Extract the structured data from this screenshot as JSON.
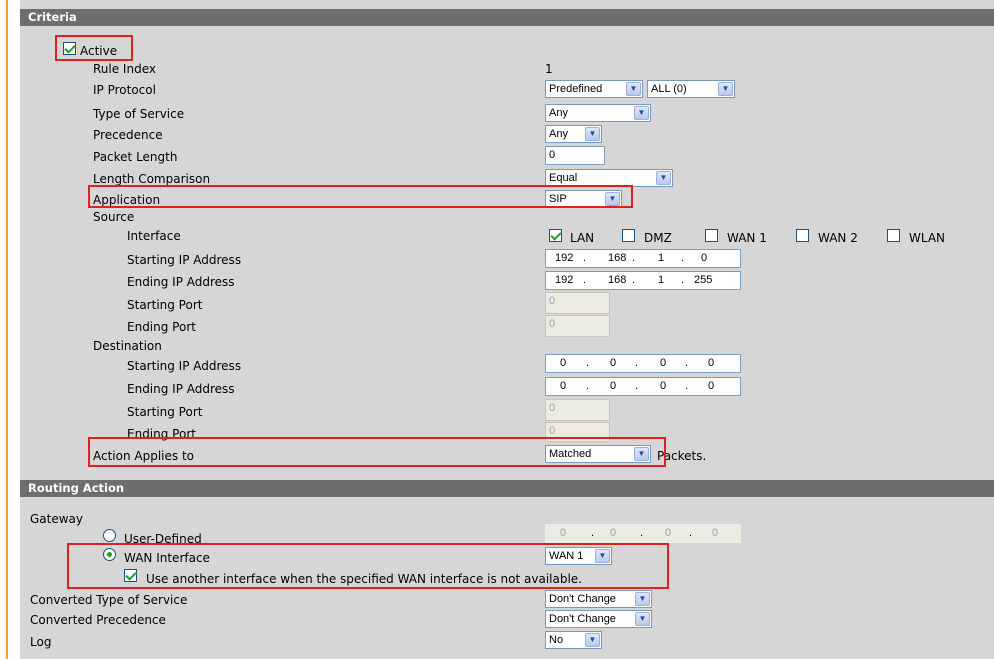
{
  "criteria": {
    "header": "Criteria",
    "active_label": "Active",
    "rule_index_label": "Rule Index",
    "rule_index_value": "1",
    "ip_protocol_label": "IP Protocol",
    "ip_protocol_value": "Predefined",
    "ip_protocol_sub_value": "ALL (0)",
    "tos_label": "Type of Service",
    "tos_value": "Any",
    "precedence_label": "Precedence",
    "precedence_value": "Any",
    "packet_length_label": "Packet Length",
    "packet_length_value": "0",
    "length_comparison_label": "Length Comparison",
    "length_comparison_value": "Equal",
    "application_label": "Application",
    "application_value": "SIP",
    "source_label": "Source",
    "interface_label": "Interface",
    "interfaces": [
      {
        "label": "LAN",
        "checked": true
      },
      {
        "label": "DMZ",
        "checked": false
      },
      {
        "label": "WAN 1",
        "checked": false
      },
      {
        "label": "WAN 2",
        "checked": false
      },
      {
        "label": "WLAN",
        "checked": false
      }
    ],
    "src_start_ip_label": "Starting IP Address",
    "src_start_ip": [
      "192",
      "168",
      "1",
      "0"
    ],
    "src_end_ip_label": "Ending IP Address",
    "src_end_ip": [
      "192",
      "168",
      "1",
      "255"
    ],
    "src_start_port_label": "Starting Port",
    "src_start_port": "0",
    "src_end_port_label": "Ending Port",
    "src_end_port": "0",
    "destination_label": "Destination",
    "dst_start_ip_label": "Starting IP Address",
    "dst_start_ip": [
      "0",
      "0",
      "0",
      "0"
    ],
    "dst_end_ip_label": "Ending IP Address",
    "dst_end_ip": [
      "0",
      "0",
      "0",
      "0"
    ],
    "dst_start_port_label": "Starting Port",
    "dst_start_port": "0",
    "dst_end_port_label": "Ending Port",
    "dst_end_port": "0",
    "action_applies_label": "Action Applies to",
    "action_applies_value": "Matched",
    "packets_label": "Packets."
  },
  "routing": {
    "header": "Routing Action",
    "gateway_label": "Gateway",
    "user_defined_label": "User-Defined",
    "user_defined_ip": [
      "0",
      "0",
      "0",
      "0"
    ],
    "wan_interface_label": "WAN Interface",
    "wan_interface_value": "WAN 1",
    "fallback_label": "Use another interface when the specified WAN interface is not available.",
    "converted_tos_label": "Converted Type of Service",
    "converted_tos_value": "Don't Change",
    "converted_precedence_label": "Converted Precedence",
    "converted_precedence_value": "Don't Change",
    "log_label": "Log",
    "log_value": "No"
  },
  "colors": {
    "panel": "#d6d6d6",
    "header": "#6e6e6e",
    "highlight": "#e02020",
    "check": "#21a121"
  }
}
